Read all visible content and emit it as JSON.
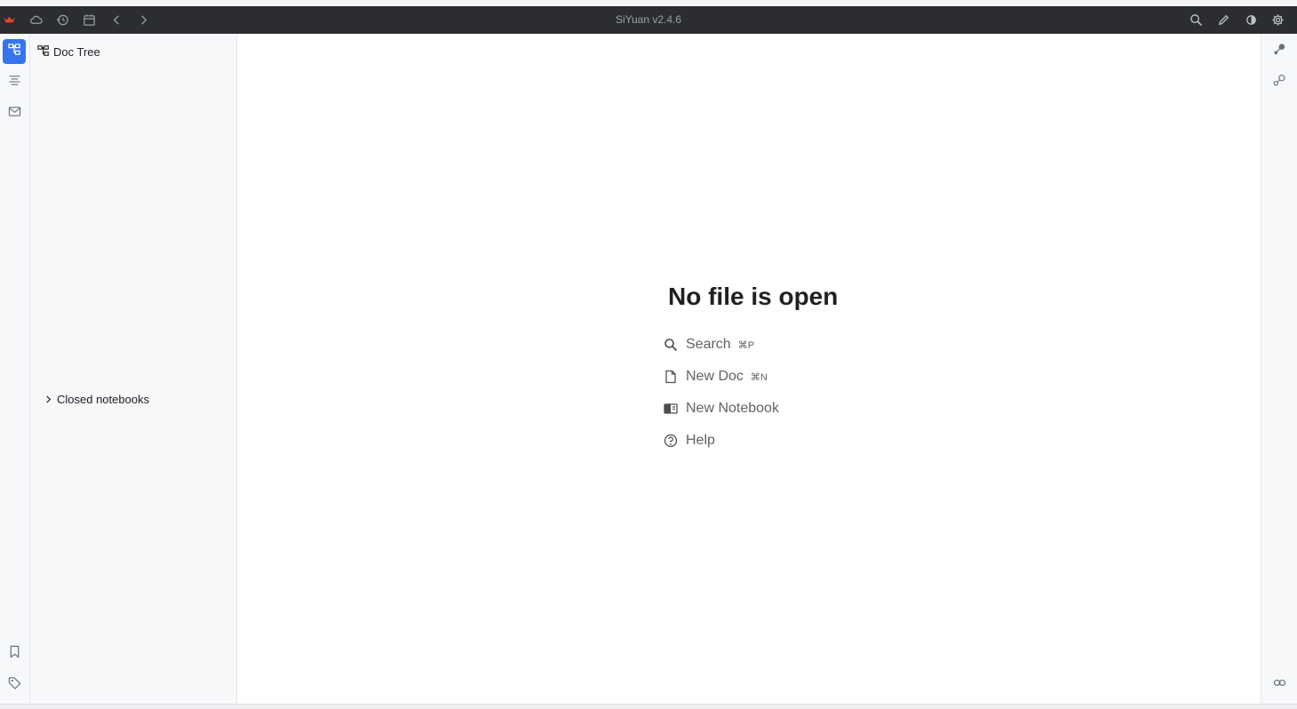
{
  "titlebar": {
    "title": "SiYuan v2.4.6",
    "brand_color": "#e8472f",
    "left_icons": [
      "siyuan-logo-icon",
      "cloud-icon",
      "history-icon",
      "calendar-icon",
      "back-icon",
      "forward-icon"
    ],
    "right_icons": [
      "search-icon",
      "edit-icon",
      "theme-mode-icon",
      "settings-icon"
    ]
  },
  "left_dock": {
    "accent_color": "#3573f0",
    "items": [
      "file-tree-icon",
      "outline-icon",
      "inbox-icon"
    ],
    "bottom_items": [
      "bookmark-icon",
      "tag-icon"
    ]
  },
  "file_tree": {
    "title": "Doc Tree",
    "closed_notebooks_label": "Closed notebooks"
  },
  "editor": {
    "empty_title": "No file is open",
    "actions": [
      {
        "label": "Search",
        "shortcut": "⌘P",
        "icon": "search-icon"
      },
      {
        "label": "New Doc",
        "shortcut": "⌘N",
        "icon": "new-doc-icon"
      },
      {
        "label": "New Notebook",
        "shortcut": "",
        "icon": "notebook-icon"
      },
      {
        "label": "Help",
        "shortcut": "",
        "icon": "help-icon"
      }
    ]
  },
  "right_dock": {
    "items": [
      "graph-icon",
      "global-graph-icon"
    ],
    "bottom_items": [
      "backlink-icon"
    ]
  }
}
